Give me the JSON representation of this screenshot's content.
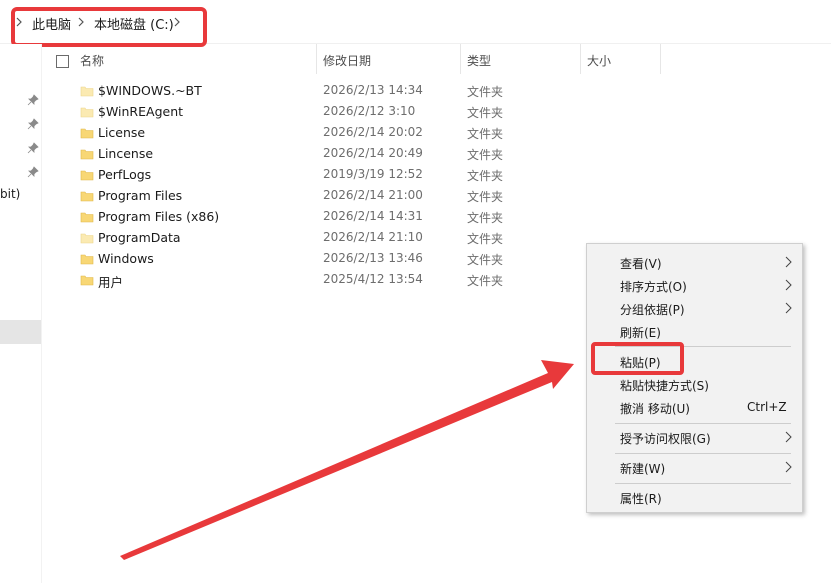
{
  "address": {
    "crumbs": [
      "此电脑",
      "本地磁盘 (C:)"
    ]
  },
  "nav": {
    "partial_text": "bit)"
  },
  "header": {
    "name": "名称",
    "modified": "修改日期",
    "type": "类型",
    "size": "大小"
  },
  "files": [
    {
      "name": "$WINDOWS.~BT",
      "modified": "2026/2/13 14:34",
      "type": "文件夹",
      "faded": true
    },
    {
      "name": "$WinREAgent",
      "modified": "2026/2/12 3:10",
      "type": "文件夹",
      "faded": true
    },
    {
      "name": "License",
      "modified": "2026/2/14 20:02",
      "type": "文件夹",
      "faded": false
    },
    {
      "name": "Lincense",
      "modified": "2026/2/14 20:49",
      "type": "文件夹",
      "faded": false
    },
    {
      "name": "PerfLogs",
      "modified": "2019/3/19 12:52",
      "type": "文件夹",
      "faded": false
    },
    {
      "name": "Program Files",
      "modified": "2026/2/14 21:00",
      "type": "文件夹",
      "faded": false
    },
    {
      "name": "Program Files (x86)",
      "modified": "2026/2/14 14:31",
      "type": "文件夹",
      "faded": false
    },
    {
      "name": "ProgramData",
      "modified": "2026/2/14 21:10",
      "type": "文件夹",
      "faded": true
    },
    {
      "name": "Windows",
      "modified": "2026/2/13 13:46",
      "type": "文件夹",
      "faded": false
    },
    {
      "name": "用户",
      "modified": "2025/4/12 13:54",
      "type": "文件夹",
      "faded": false
    }
  ],
  "context_menu": {
    "items": [
      {
        "label": "查看(V)",
        "submenu": true,
        "shortcut": ""
      },
      {
        "label": "排序方式(O)",
        "submenu": true,
        "shortcut": ""
      },
      {
        "label": "分组依据(P)",
        "submenu": true,
        "shortcut": ""
      },
      {
        "label": "刷新(E)",
        "submenu": false,
        "shortcut": ""
      },
      {
        "label": "粘贴(P)",
        "submenu": false,
        "shortcut": ""
      },
      {
        "label": "粘贴快捷方式(S)",
        "submenu": false,
        "shortcut": ""
      },
      {
        "label": "撤消 移动(U)",
        "submenu": false,
        "shortcut": "Ctrl+Z"
      },
      {
        "label": "授予访问权限(G)",
        "submenu": true,
        "shortcut": ""
      },
      {
        "label": "新建(W)",
        "submenu": true,
        "shortcut": ""
      },
      {
        "label": "属性(R)",
        "submenu": false,
        "shortcut": ""
      }
    ]
  },
  "colors": {
    "highlight": "#e8393b",
    "folder": "#f8d775",
    "folder_faded": "#fbeab2",
    "menu_bg": "#f2f2f2"
  },
  "icons": {
    "folder": "folder-icon",
    "pin": "pin-icon",
    "chevron": "chevron-right-icon"
  }
}
